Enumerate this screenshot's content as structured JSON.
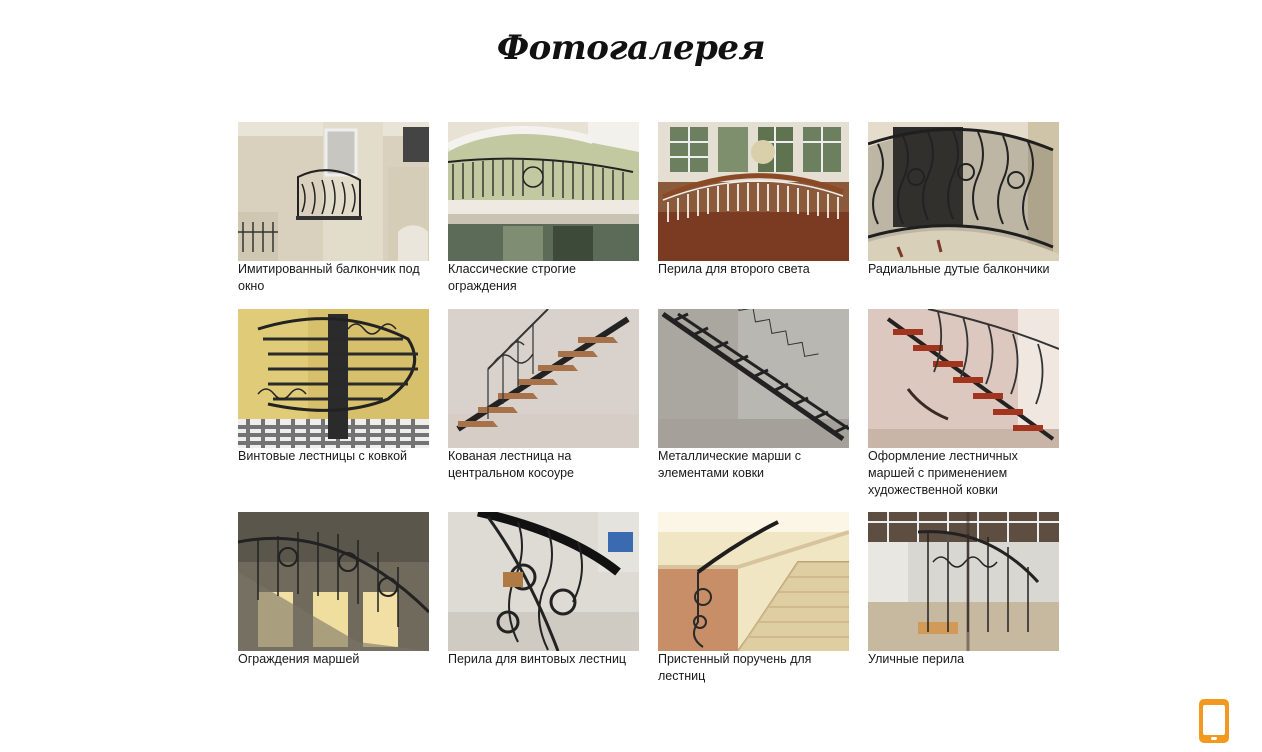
{
  "page": {
    "title": "Фотогалерея"
  },
  "gallery": {
    "items": [
      {
        "caption": "Имитированный балкончик под окно"
      },
      {
        "caption": "Классические строгие ограждения"
      },
      {
        "caption": "Перила для второго света"
      },
      {
        "caption": "Радиальные дутые балкончики"
      },
      {
        "caption": "Винтовые лестницы с ковкой"
      },
      {
        "caption": "Кованая лестница на центральном косоуре"
      },
      {
        "caption": "Металлические марши с элементами ковки"
      },
      {
        "caption": "Оформление лестничных маршей с применением художественной ковки"
      },
      {
        "caption": "Ограждения маршей"
      },
      {
        "caption": "Перила для винтовых лестниц"
      },
      {
        "caption": "Пристенный поручень для лестниц"
      },
      {
        "caption": "Уличные перила"
      }
    ]
  },
  "floating": {
    "icon": "phone-apple-icon",
    "apple_glyph": ""
  },
  "colors": {
    "accent": "#f29a1f"
  }
}
